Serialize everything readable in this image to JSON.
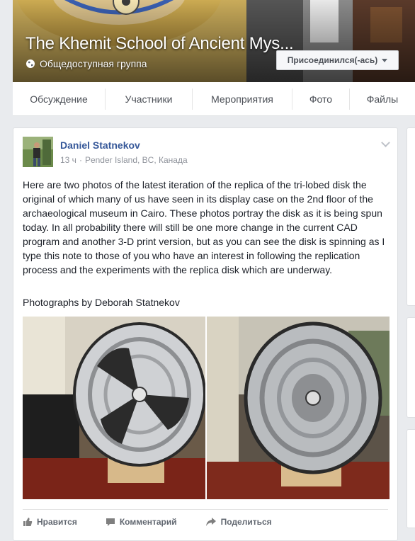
{
  "group": {
    "title": "The Khemit School of Ancient Mys...",
    "privacy": "Общедоступная группа",
    "joined_button": "Присоединился(-ась)"
  },
  "tabs": [
    {
      "label": "Обсуждение"
    },
    {
      "label": "Участники"
    },
    {
      "label": "Мероприятия"
    },
    {
      "label": "Фото"
    },
    {
      "label": "Файлы"
    }
  ],
  "post": {
    "author": "Daniel Statnekov",
    "time": "13 ч",
    "separator": "·",
    "location": "Pender Island, BC, Канада",
    "text": "Here are two photos of the latest iteration of the replica of the tri-lobed disk the original of which many of us have seen in its display case on the 2nd floor of the archaeological museum in Cairo. These photos portray the disk as it is being spun today. In all probability there will still be one more change in the current CAD program and another 3-D print version, but as you can see the disk is spinning as I type this note to those of you who have an interest in following the replication process and the experiments with the replica disk which are underway.",
    "credit": "Photographs by Deborah Statnekov",
    "actions": {
      "like": "Нравится",
      "comment": "Комментарий",
      "share": "Поделиться"
    }
  },
  "icons": {
    "globe": "globe-icon",
    "caret": "caret-down-icon",
    "chevron": "chevron-down-icon",
    "like": "thumbs-up-icon",
    "comment": "comment-icon",
    "share": "share-arrow-icon"
  },
  "colors": {
    "link": "#365899",
    "muted": "#90949c",
    "action": "#616770",
    "page_bg": "#e9ebee"
  }
}
